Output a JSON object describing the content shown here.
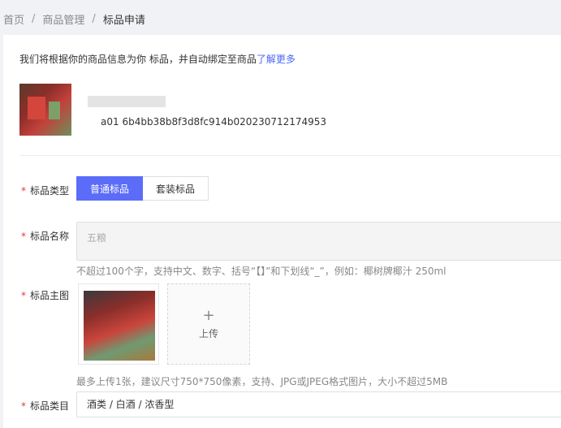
{
  "breadcrumb": {
    "items": [
      "首页",
      "商品管理",
      "标品申请"
    ],
    "separator": "/"
  },
  "intro": {
    "text": "我们将根据你的商品信息为你      标品，并自动绑定至商品",
    "link": "了解更多"
  },
  "product": {
    "id_text": "a01              6b4bb38b8f3d8fc914b020230712174953"
  },
  "form": {
    "type_label": "标品类型",
    "type_options": [
      "普通标品",
      "套装标品"
    ],
    "type_selected": "普通标品",
    "name_label": "标品名称",
    "name_value": "五粮",
    "name_hint": "不超过100个字，支持中文、数字、括号“【】”和下划线“_”，例如：椰树牌椰汁 250ml",
    "image_label": "标品主图",
    "upload_label": "上传",
    "image_hint": "最多上传1张，建议尺寸750*750像素，支持、JPG或JPEG格式图片，大小不超过5MB",
    "category_label": "标品类目",
    "category_value": "酒类 / 白酒 / 浓香型",
    "required_mark": "*"
  },
  "colors": {
    "accent": "#5b6cf8",
    "link": "#4a67f5",
    "required": "#e0393e"
  },
  "icons": {
    "upload": "plus-icon"
  }
}
